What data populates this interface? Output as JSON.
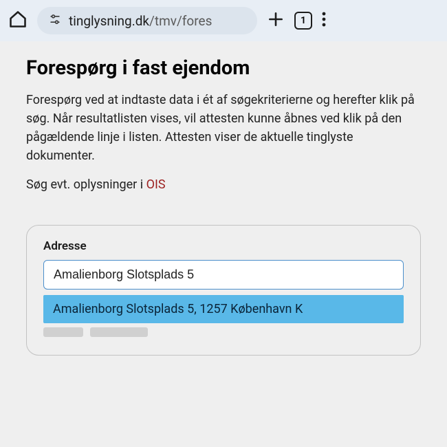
{
  "browser": {
    "url_host": "tinglysning.dk",
    "url_path": "/tmv/fores",
    "tab_count": "1"
  },
  "page": {
    "title": "Forespørg i fast ejendom",
    "description": "Forespørg ved at indtaste data i ét af søgekriterierne og herefter klik på søg. Når resultatlisten vises, vil attesten kunne åbnes ved klik på den pågældende linje i listen. Attesten viser de aktuelle tinglyste dokumenter.",
    "secondary_prefix": "Søg evt. oplysninger i ",
    "ois_link_label": "OIS"
  },
  "search": {
    "field_label": "Adresse",
    "input_value": "Amalienborg Slotsplads 5",
    "suggestion": "Amalienborg Slotsplads 5, 1257 København K"
  }
}
